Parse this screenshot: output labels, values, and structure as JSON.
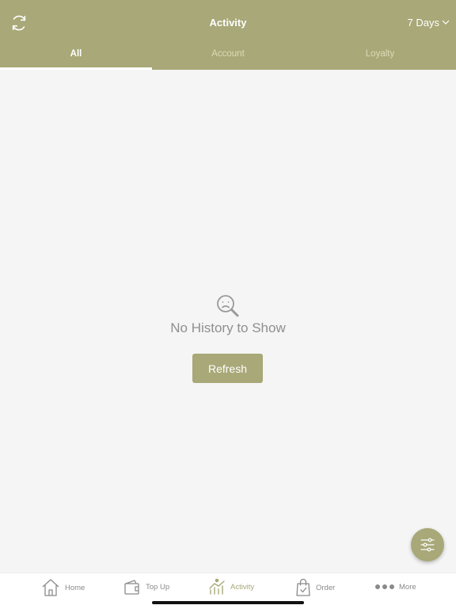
{
  "header": {
    "title": "Activity",
    "range_label": "7 Days",
    "refresh_icon": "refresh-icon",
    "range_icon": "chevron-down-icon"
  },
  "tabs": [
    {
      "label": "All",
      "active": true
    },
    {
      "label": "Account",
      "active": false
    },
    {
      "label": "Loyalty",
      "active": false
    }
  ],
  "empty_state": {
    "icon": "sad-search-icon",
    "message": "No History to Show",
    "button_label": "Refresh"
  },
  "fab": {
    "icon": "filter-sliders-icon"
  },
  "bottom_nav": [
    {
      "label": "Home",
      "icon": "home-icon",
      "active": false
    },
    {
      "label": "Top Up",
      "icon": "wallet-icon",
      "active": false
    },
    {
      "label": "Activity",
      "icon": "activity-chart-icon",
      "active": true
    },
    {
      "label": "Order",
      "icon": "shopping-bag-icon",
      "active": false
    },
    {
      "label": "More",
      "icon": "more-dots-icon",
      "active": false
    }
  ],
  "colors": {
    "brand": "#a8a878",
    "background": "#f5f5f5",
    "tab_inactive": "#dcdcb8",
    "nav_text": "#8a8a8a"
  }
}
